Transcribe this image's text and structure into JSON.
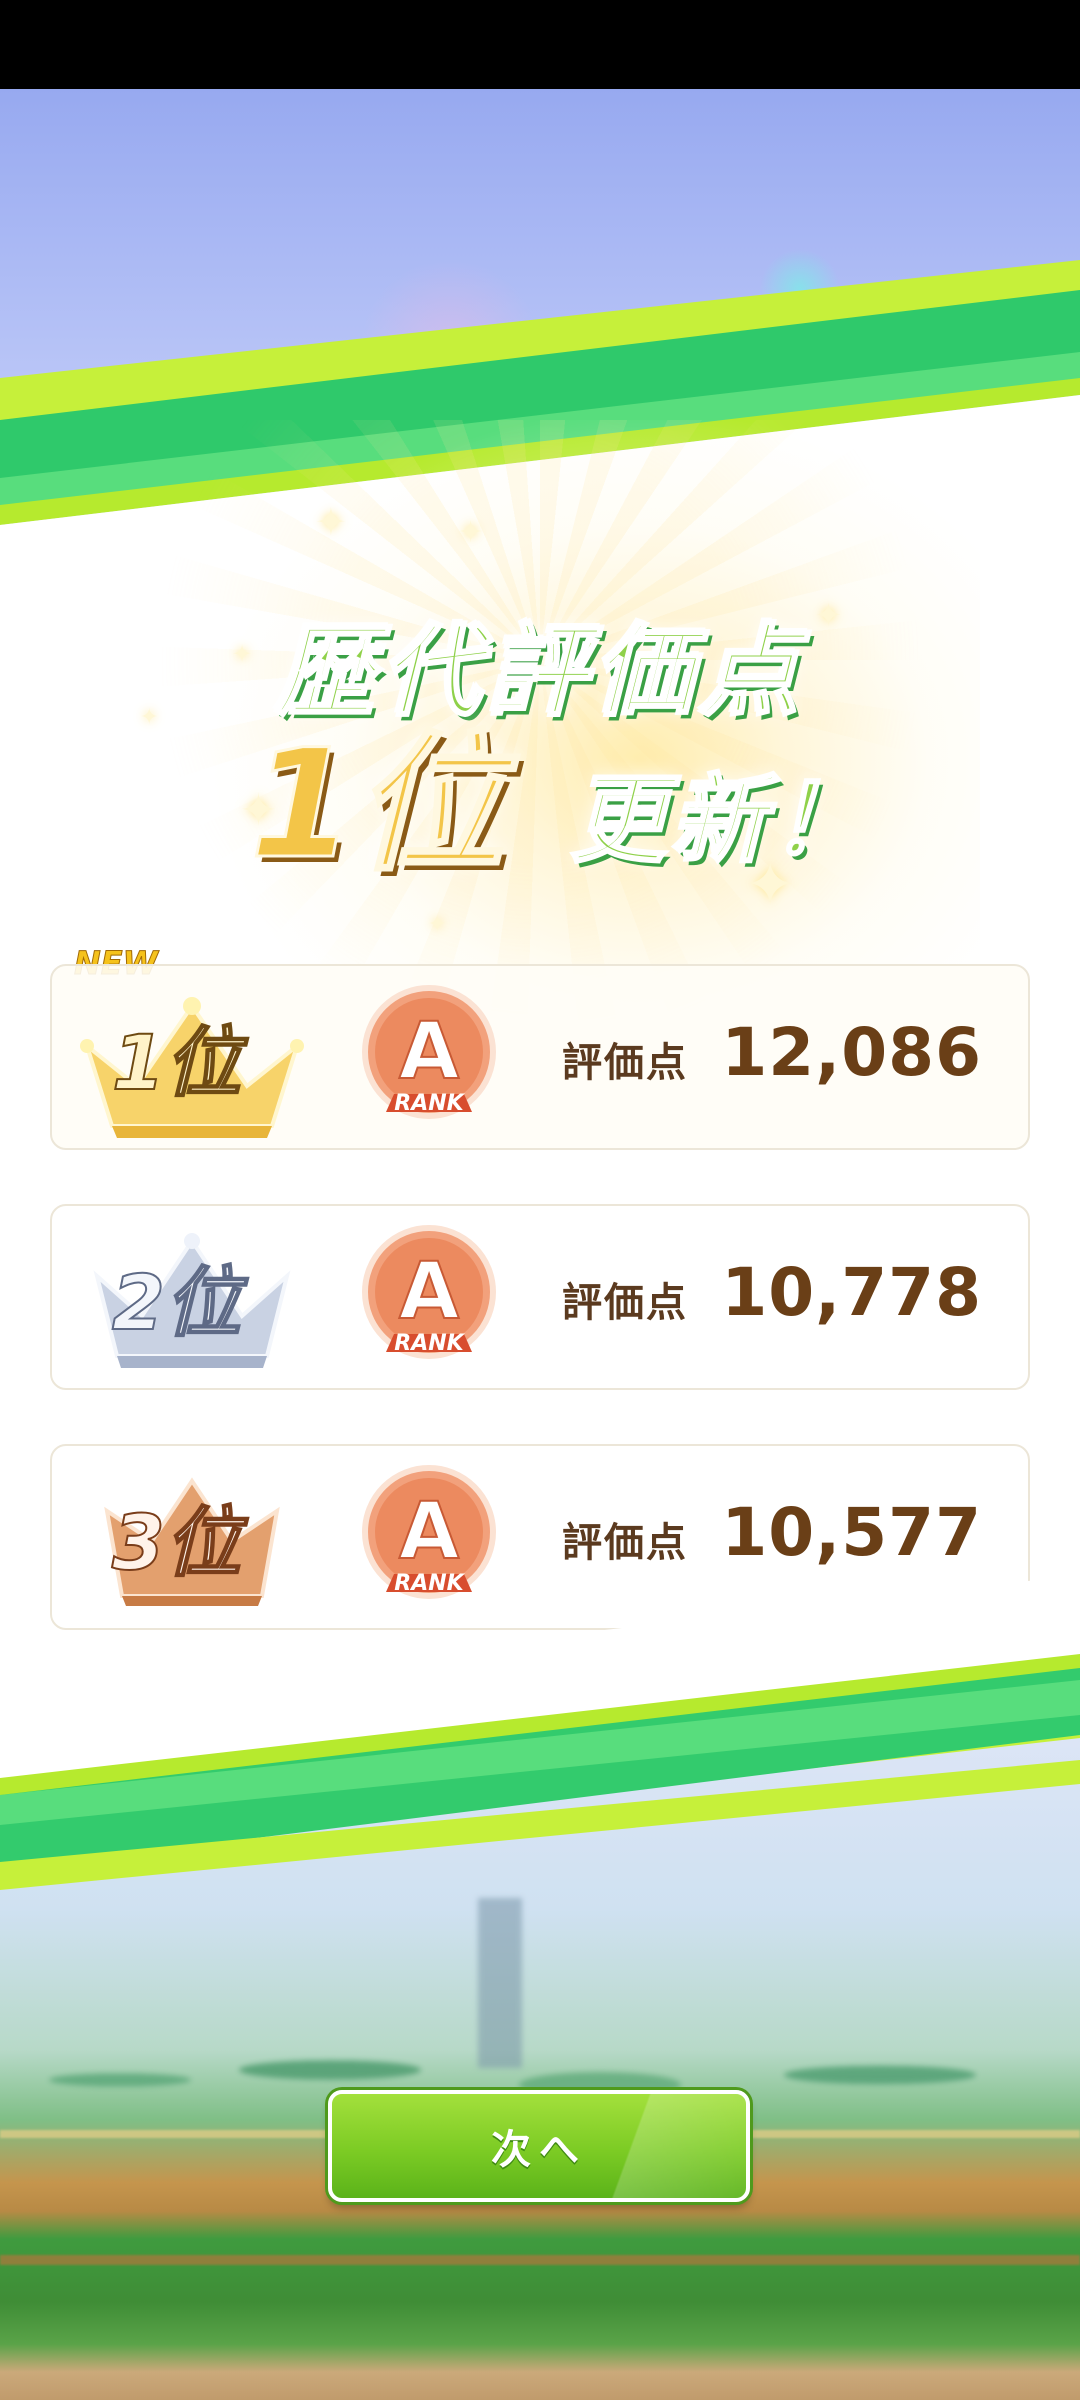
{
  "header": {
    "title": "歴代評価点",
    "rank_number": "1位",
    "rank_suffix": "更新！"
  },
  "new_tag": "NEW",
  "rankings": [
    {
      "place": "1位",
      "tier": "gold",
      "rank_grade": "A",
      "rank_word": "RANK",
      "score_label": "評価点",
      "score": "12,086"
    },
    {
      "place": "2位",
      "tier": "silver",
      "rank_grade": "A",
      "rank_word": "RANK",
      "score_label": "評価点",
      "score": "10,778"
    },
    {
      "place": "3位",
      "tier": "bronze",
      "rank_grade": "A",
      "rank_word": "RANK",
      "score_label": "評価点",
      "score": "10,577"
    }
  ],
  "footer": {
    "next_label": "次へ"
  },
  "colors": {
    "accent_green": "#7ccb24",
    "score_brown": "#6a3f17",
    "gold": "#f3c548",
    "silver": "#b9c4d8",
    "bronze": "#d9874e",
    "badge_orange": "#e8774a"
  },
  "icons": {
    "gold_crown": "crown-gold-icon",
    "silver_crown": "crown-silver-icon",
    "bronze_crown": "crown-bronze-icon",
    "rank_badge": "rank-a-badge-icon"
  }
}
